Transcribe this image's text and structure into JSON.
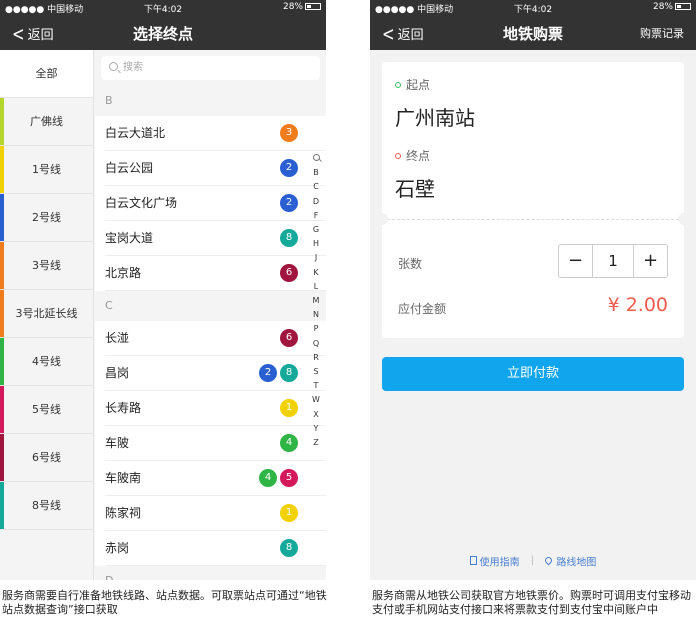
{
  "status_bar": {
    "carrier": "●●●●● 中国移动",
    "time": "下午4:02",
    "battery": "28%"
  },
  "left_screen": {
    "nav": {
      "back_label": "返回",
      "title": "选择终点"
    },
    "search": {
      "placeholder": "搜索"
    },
    "lines": [
      {
        "label": "全部",
        "color": ""
      },
      {
        "label": "广佛线",
        "color": "#b4d52a"
      },
      {
        "label": "1号线",
        "color": "#f2d100"
      },
      {
        "label": "2号线",
        "color": "#2a5fd1"
      },
      {
        "label": "3号线",
        "color": "#f07c1c"
      },
      {
        "label": "3号北延长线",
        "color": "#f07c1c"
      },
      {
        "label": "4号线",
        "color": "#2fb446"
      },
      {
        "label": "5号线",
        "color": "#d4195a"
      },
      {
        "label": "6号线",
        "color": "#a0163f"
      },
      {
        "label": "8号线",
        "color": "#14a99a"
      }
    ],
    "sections": [
      {
        "letter": "B",
        "stations": [
          {
            "name": "白云大道北",
            "badges": [
              {
                "n": "3",
                "color": "#f07c1c"
              }
            ]
          },
          {
            "name": "白云公园",
            "badges": [
              {
                "n": "2",
                "color": "#2a5fd1"
              }
            ]
          },
          {
            "name": "白云文化广场",
            "badges": [
              {
                "n": "2",
                "color": "#2a5fd1"
              }
            ]
          },
          {
            "name": "宝岗大道",
            "badges": [
              {
                "n": "8",
                "color": "#14a99a"
              }
            ]
          },
          {
            "name": "北京路",
            "badges": [
              {
                "n": "6",
                "color": "#a0163f"
              }
            ]
          }
        ]
      },
      {
        "letter": "C",
        "stations": [
          {
            "name": "长湴",
            "badges": [
              {
                "n": "6",
                "color": "#a0163f"
              }
            ]
          },
          {
            "name": "昌岗",
            "badges": [
              {
                "n": "2",
                "color": "#2a5fd1"
              },
              {
                "n": "8",
                "color": "#14a99a"
              }
            ]
          },
          {
            "name": "长寿路",
            "badges": [
              {
                "n": "1",
                "color": "#f2d100"
              }
            ]
          },
          {
            "name": "车陂",
            "badges": [
              {
                "n": "4",
                "color": "#2fb446"
              }
            ]
          },
          {
            "name": "车陂南",
            "badges": [
              {
                "n": "4",
                "color": "#2fb446"
              },
              {
                "n": "5",
                "color": "#d4195a"
              }
            ]
          },
          {
            "name": "陈家祠",
            "badges": [
              {
                "n": "1",
                "color": "#f2d100"
              }
            ]
          },
          {
            "name": "赤岗",
            "badges": [
              {
                "n": "8",
                "color": "#14a99a"
              }
            ]
          }
        ]
      },
      {
        "letter": "D",
        "stations": []
      }
    ],
    "index_letters": [
      "B",
      "C",
      "D",
      "F",
      "G",
      "H",
      "J",
      "K",
      "L",
      "M",
      "N",
      "P",
      "Q",
      "R",
      "S",
      "T",
      "W",
      "X",
      "Y",
      "Z"
    ]
  },
  "right_screen": {
    "nav": {
      "back_label": "返回",
      "title": "地铁购票",
      "right_label": "购票记录"
    },
    "origin": {
      "label": "起点",
      "name": "广州南站",
      "dot_color": "#3cc35f"
    },
    "destination": {
      "label": "终点",
      "name": "石壁",
      "dot_color": "#f25a4f"
    },
    "quantity": {
      "label": "张数",
      "minus": "−",
      "value": "1",
      "plus": "+"
    },
    "amount": {
      "label": "应付金额",
      "value": "¥ 2.00"
    },
    "pay_button": "立即付款",
    "links": {
      "guide": "使用指南",
      "separator": "|",
      "map": "路线地图"
    }
  },
  "captions": {
    "left": "服务商需要自行准备地铁线路、站点数据。可取票站点可通过“地铁站点数据查询”接口获取",
    "right": "服务商需从地铁公司获取官方地铁票价。购票时可调用支付宝移动支付或手机网站支付接口来将票款支付到支付宝中间账户中"
  }
}
